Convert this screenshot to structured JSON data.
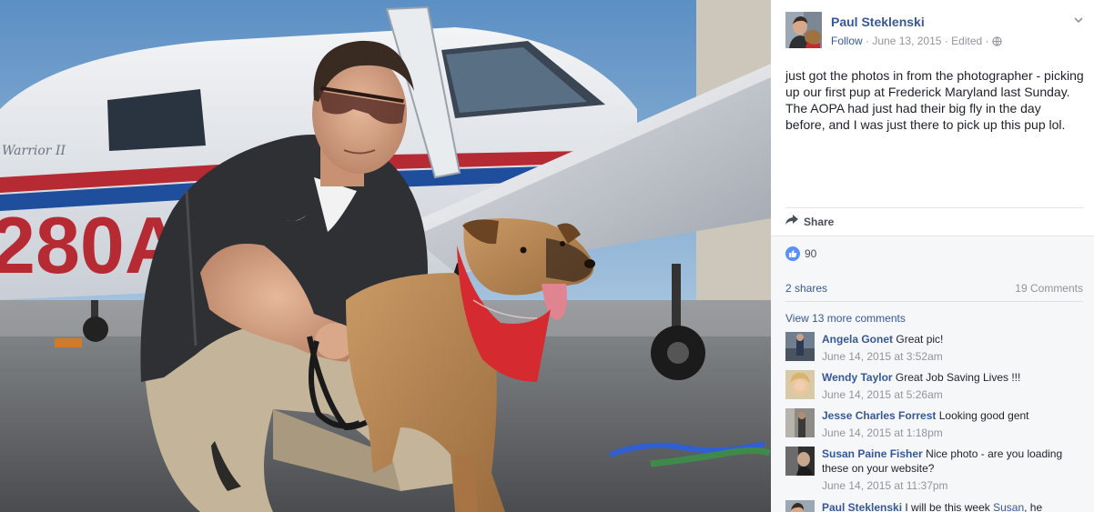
{
  "post": {
    "author": "Paul Steklenski",
    "follow_label": "Follow",
    "date": "June 13, 2015",
    "edited_label": "Edited",
    "text": "just got the photos in from the photographer - picking up our first pup at Frederick Maryland last Sunday. The AOPA had just had their big fly in the day before, and I was just there to pick up this pup lol."
  },
  "actions": {
    "share_label": "Share"
  },
  "stats": {
    "likes": "90",
    "shares": "2 shares",
    "comments_count": "19 Comments"
  },
  "comments_section": {
    "view_more": "View 13 more comments",
    "comments": [
      {
        "name": "Angela Gonet",
        "text": "Great pic!",
        "time": "June 14, 2015 at 3:52am"
      },
      {
        "name": "Wendy Taylor",
        "text": "Great Job Saving Lives !!!",
        "time": "June 14, 2015 at 5:26am"
      },
      {
        "name": "Jesse Charles Forrest",
        "text": "Looking good gent",
        "time": "June 14, 2015 at 1:18pm"
      },
      {
        "name": "Susan Paine Fisher",
        "text": "Nice photo - are you loading these on your website?",
        "time": "June 14, 2015 at 11:37pm"
      },
      {
        "name": "Paul Steklenski",
        "text": "I will be this week",
        "mention": "Susan",
        "text_after": ", he"
      }
    ]
  },
  "photo": {
    "tail_number_text": "280A",
    "plane_model_text": "Warrior II"
  },
  "icons": {
    "share": "share-arrow-icon",
    "like": "thumbs-up-icon",
    "privacy": "globe-icon",
    "options": "chevron-down-icon"
  },
  "colors": {
    "link": "#365899",
    "meta": "#90949c",
    "like_badge": "#5890ff",
    "feedback_bg": "#f6f7f9"
  }
}
